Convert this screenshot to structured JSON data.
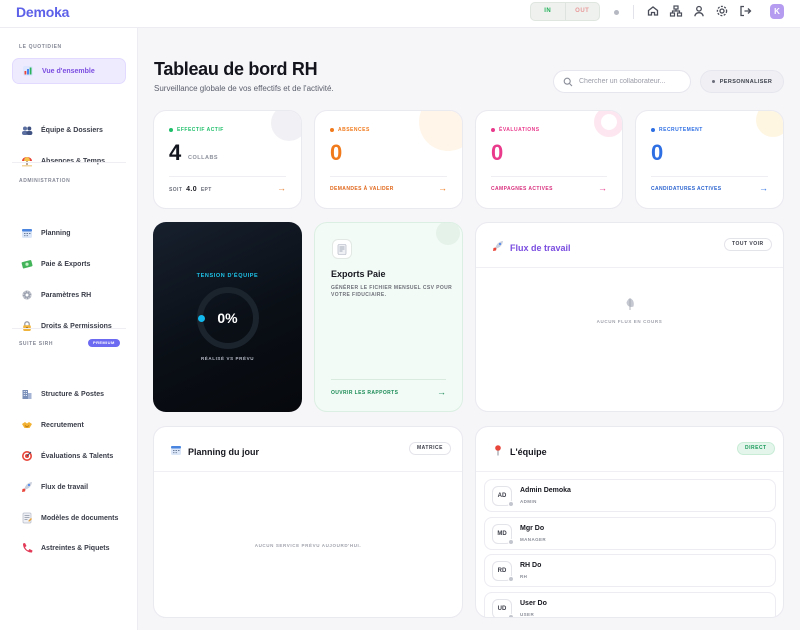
{
  "app": {
    "name": "Demoka",
    "avatar_letter": "K",
    "accent": "#5d60e8"
  },
  "topbar": {
    "clock_in": "IN",
    "clock_out": "OUT",
    "icons": [
      "status-dot-icon",
      "home-icon",
      "org-chart-icon",
      "user-icon",
      "gear-icon",
      "logout-icon"
    ]
  },
  "sidebar": {
    "sections": [
      {
        "title": "LE QUOTIDIEN",
        "items": [
          {
            "label": "Vue d'ensemble",
            "icon": "bar-chart-icon",
            "active": true
          },
          {
            "label": "Équipe & Dossiers",
            "icon": "users-icon"
          },
          {
            "label": "Absences & Temps",
            "icon": "beach-icon"
          }
        ]
      },
      {
        "title": "ADMINISTRATION",
        "items": [
          {
            "label": "Planning",
            "icon": "calendar-icon"
          },
          {
            "label": "Paie & Exports",
            "icon": "money-icon"
          },
          {
            "label": "Paramètres RH",
            "icon": "gear-icon"
          },
          {
            "label": "Droits & Permissions",
            "icon": "lock-icon"
          }
        ]
      },
      {
        "title": "SUITE SIRH",
        "badge": "PREMIUM",
        "items": [
          {
            "label": "Structure & Postes",
            "icon": "building-icon"
          },
          {
            "label": "Recrutement",
            "icon": "handshake-icon"
          },
          {
            "label": "Évaluations & Talents",
            "icon": "target-icon"
          },
          {
            "label": "Flux de travail",
            "icon": "rocket-icon"
          },
          {
            "label": "Modèles de documents",
            "icon": "document-icon"
          },
          {
            "label": "Astreintes & Piquets",
            "icon": "phone-icon"
          }
        ]
      }
    ]
  },
  "header": {
    "title": "Tableau de bord RH",
    "subtitle": "Surveillance globale de vos effectifs et de l'activité.",
    "search_placeholder": "Chercher un collaborateur...",
    "customize_label": "PERSONNALISER"
  },
  "stats": {
    "effectif": {
      "label": "EFFECTIF ACTIF",
      "value": "4",
      "unit": "COLLABS",
      "foot_prefix": "SOIT",
      "foot_value": "4.0",
      "foot_suffix": "EPT",
      "color": "#1fbf6a"
    },
    "absences": {
      "label": "ABSENCES",
      "value": "0",
      "foot": "DEMANDES À VALIDER",
      "color": "#f07a1c"
    },
    "evaluations": {
      "label": "ÉVALUATIONS",
      "value": "0",
      "foot": "CAMPAGNES ACTIVES",
      "color": "#e93a8c"
    },
    "recrutement": {
      "label": "RECRUTEMENT",
      "value": "0",
      "foot": "CANDIDATURES ACTIVES",
      "color": "#2f6fe4"
    }
  },
  "tension": {
    "title": "TENSION D'ÉQUIPE",
    "value": "0%",
    "level": 0,
    "subtitle": "RÉALISÉ VS PRÉVU"
  },
  "exports": {
    "title": "Exports Paie",
    "description": "GÉNÉRER LE FICHIER MENSUEL CSV POUR VOTRE FIDUCIAIRE.",
    "link": "OUVRIR LES RAPPORTS"
  },
  "workflow": {
    "title": "Flux de travail",
    "button": "TOUT VOIR",
    "empty": "AUCUN FLUX EN COURS"
  },
  "planning": {
    "title": "Planning du jour",
    "button": "MATRICE",
    "empty": "AUCUN SERVICE PRÉVU AUJOURD'HUI."
  },
  "team": {
    "title": "L'équipe",
    "badge": "DIRECT",
    "members": [
      {
        "initials": "AD",
        "name": "Admin Demoka",
        "role": "ADMIN"
      },
      {
        "initials": "MD",
        "name": "Mgr Do",
        "role": "MANAGER"
      },
      {
        "initials": "RD",
        "name": "RH Do",
        "role": "RH"
      },
      {
        "initials": "UD",
        "name": "User Do",
        "role": "USER"
      }
    ]
  }
}
